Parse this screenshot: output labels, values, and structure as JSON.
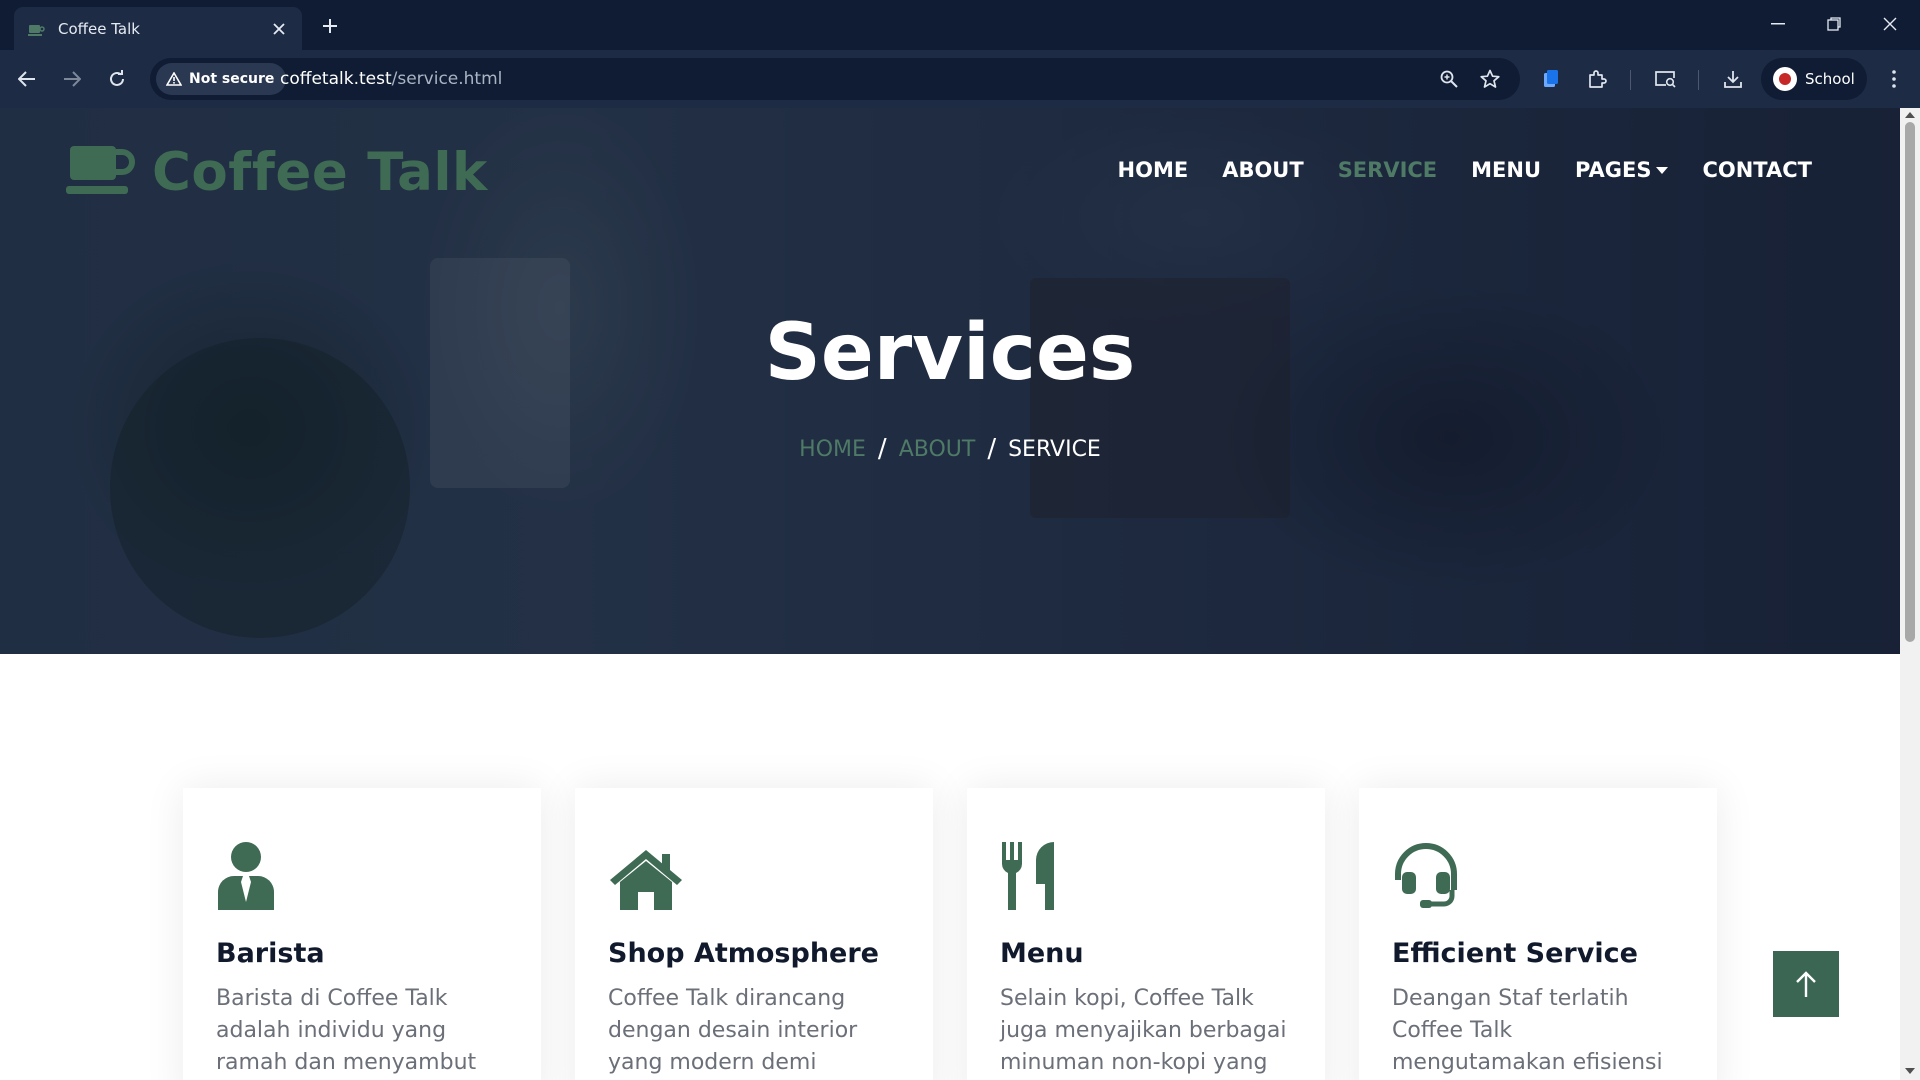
{
  "browser": {
    "tab_title": "Coffee Talk",
    "security_label": "Not secure",
    "url_host": "coffetalk.test",
    "url_path": "/service.html",
    "profile_name": "School"
  },
  "site": {
    "logo_text": "Coffee Talk",
    "brand_color": "#3f6b54",
    "nav": [
      {
        "label": "HOME",
        "active": false
      },
      {
        "label": "ABOUT",
        "active": false
      },
      {
        "label": "SERVICE",
        "active": true
      },
      {
        "label": "MENU",
        "active": false
      },
      {
        "label": "PAGES",
        "active": false,
        "dropdown": true
      },
      {
        "label": "CONTACT",
        "active": false
      }
    ]
  },
  "hero": {
    "title": "Services",
    "breadcrumb": [
      "HOME",
      "ABOUT",
      "SERVICE"
    ],
    "separator": "/"
  },
  "services": [
    {
      "icon": "user-tie-icon",
      "title": "Barista",
      "text": "Barista di Coffee Talk adalah individu yang ramah dan menyambut"
    },
    {
      "icon": "home-icon",
      "title": "Shop Atmosphere",
      "text": "Coffee Talk dirancang dengan desain interior yang modern demi"
    },
    {
      "icon": "utensils-icon",
      "title": "Menu",
      "text": "Selain kopi, Coffee Talk juga menyajikan berbagai minuman non-kopi yang"
    },
    {
      "icon": "headset-icon",
      "title": "Efficient Service",
      "text": "Deangan Staf terlatih Coffee Talk mengutamakan efisiensi"
    }
  ]
}
